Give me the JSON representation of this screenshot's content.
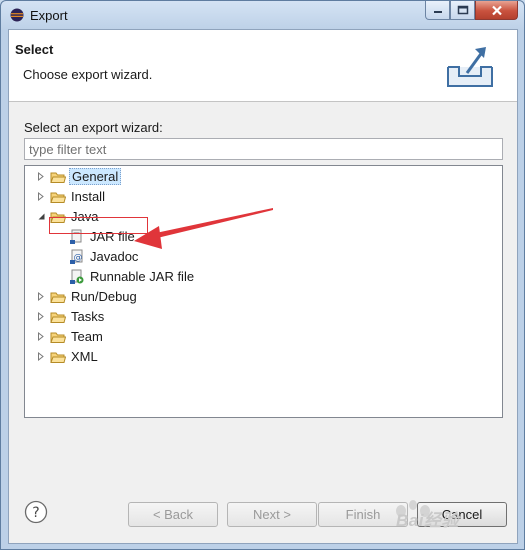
{
  "window": {
    "title": "Export",
    "app_icon": "eclipse-icon"
  },
  "header": {
    "title": "Select",
    "description": "Choose export wizard.",
    "banner_icon": "export-wizard-icon"
  },
  "filter": {
    "label": "Select an export wizard:",
    "placeholder": "type filter text",
    "value": ""
  },
  "tree": {
    "items": [
      {
        "label": "General",
        "icon": "folder-icon",
        "expanded": false,
        "selected": true
      },
      {
        "label": "Install",
        "icon": "folder-icon",
        "expanded": false
      },
      {
        "label": "Java",
        "icon": "folder-icon",
        "expanded": true,
        "children": [
          {
            "label": "JAR file",
            "icon": "jar-file-icon"
          },
          {
            "label": "Javadoc",
            "icon": "javadoc-icon"
          },
          {
            "label": "Runnable JAR file",
            "icon": "runnable-jar-icon"
          }
        ]
      },
      {
        "label": "Run/Debug",
        "icon": "folder-icon",
        "expanded": false
      },
      {
        "label": "Tasks",
        "icon": "folder-icon",
        "expanded": false
      },
      {
        "label": "Team",
        "icon": "folder-icon",
        "expanded": false
      },
      {
        "label": "XML",
        "icon": "folder-icon",
        "expanded": false
      }
    ]
  },
  "buttons": {
    "back": "< Back",
    "next": "Next >",
    "finish": "Finish",
    "cancel": "Cancel"
  },
  "watermark": {
    "text": "Bai经验"
  },
  "colors": {
    "annotation": "#e0353a",
    "folder": "#e8b84a",
    "selection": "#cce8ff"
  }
}
